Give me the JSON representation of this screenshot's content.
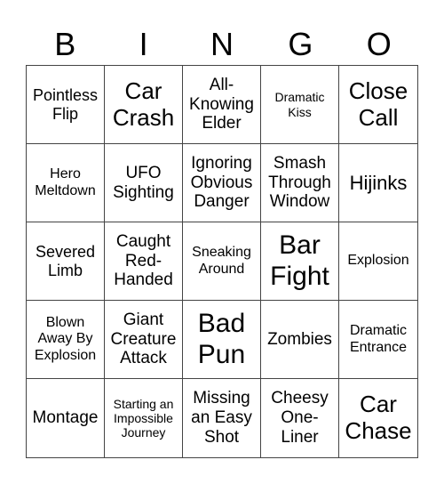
{
  "header": {
    "letters": [
      "B",
      "I",
      "N",
      "G",
      "O"
    ]
  },
  "cells": [
    "Pointless Flip",
    "Car Crash",
    "All-Knowing Elder",
    "Dramatic Kiss",
    "Close Call",
    "Hero Meltdown",
    "UFO Sighting",
    "Ignoring Obvious Danger",
    "Smash Through Window",
    "Hijinks",
    "Severed Limb",
    "Caught Red-Handed",
    "Sneaking Around",
    "Bar Fight",
    "Explosion",
    "Blown Away By Explosion",
    "Giant Creature Attack",
    "Bad Pun",
    "Zombies",
    "Dramatic Entrance",
    "Montage",
    "Starting an Impossible Journey",
    "Missing an Easy Shot",
    "Cheesy One-Liner",
    "Car Chase"
  ]
}
